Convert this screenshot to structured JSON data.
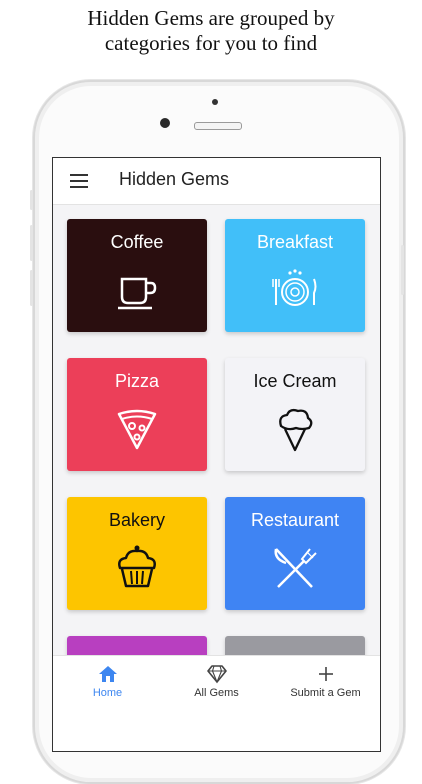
{
  "caption": {
    "line1": "Hidden Gems are grouped by",
    "line2": "categories for you to find"
  },
  "appbar": {
    "title": "Hidden Gems",
    "menu_icon": "menu-icon"
  },
  "categories": [
    {
      "label": "Coffee",
      "icon": "coffee-cup-icon",
      "bg": "#2a0e0f",
      "fg": "#ffffff"
    },
    {
      "label": "Breakfast",
      "icon": "breakfast-plate-icon",
      "bg": "#41bff9",
      "fg": "#ffffff"
    },
    {
      "label": "Pizza",
      "icon": "pizza-slice-icon",
      "bg": "#ec3f59",
      "fg": "#ffffff"
    },
    {
      "label": "Ice Cream",
      "icon": "ice-cream-icon",
      "bg": "#f3f3f7",
      "fg": "#111111"
    },
    {
      "label": "Bakery",
      "icon": "cupcake-icon",
      "bg": "#fdc500",
      "fg": "#111111"
    },
    {
      "label": "Restaurant",
      "icon": "fork-knife-icon",
      "bg": "#3f84f3",
      "fg": "#ffffff"
    },
    {
      "label": "",
      "icon": "",
      "bg": "#b83fc0",
      "fg": "#ffffff"
    },
    {
      "label": "",
      "icon": "",
      "bg": "#9a9aa0",
      "fg": "#ffffff"
    }
  ],
  "bottom_nav": [
    {
      "label": "Home",
      "icon": "home-icon",
      "active": true
    },
    {
      "label": "All Gems",
      "icon": "diamond-icon",
      "active": false
    },
    {
      "label": "Submit a Gem",
      "icon": "plus-icon",
      "active": false
    }
  ],
  "colors": {
    "accent": "#3d86f0"
  }
}
